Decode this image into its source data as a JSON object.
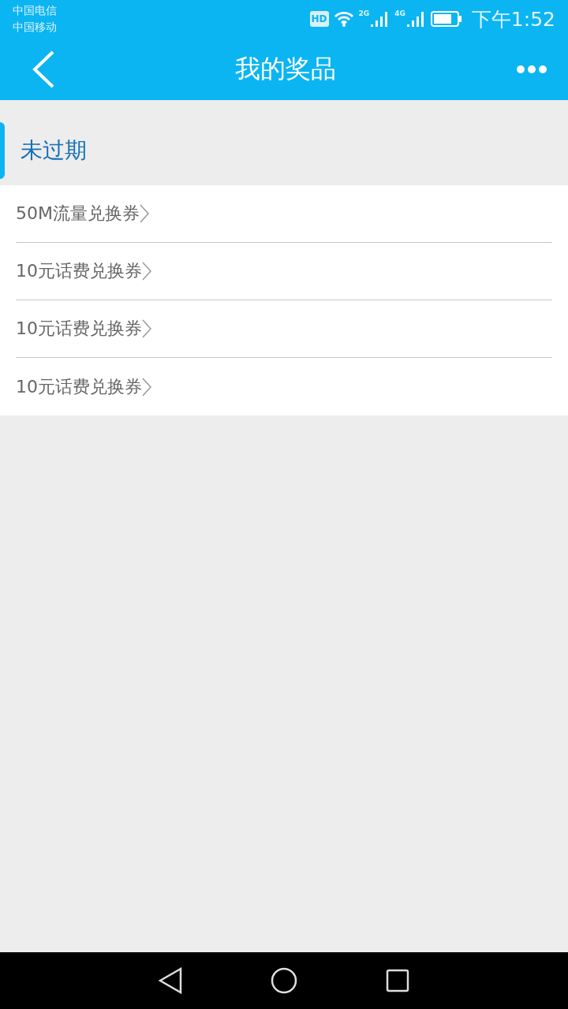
{
  "status_bar": {
    "carriers": [
      "中国电信",
      "中国移动"
    ],
    "hd_badge": "HD",
    "network_1": "2G",
    "network_2": "4G",
    "time": "下午1:52"
  },
  "app_bar": {
    "title": "我的奖品"
  },
  "section": {
    "title": "未过期"
  },
  "prizes": [
    {
      "label": "50M流量兑换券"
    },
    {
      "label": "10元话费兑换券"
    },
    {
      "label": "10元话费兑换券"
    },
    {
      "label": "10元话费兑换券"
    }
  ]
}
